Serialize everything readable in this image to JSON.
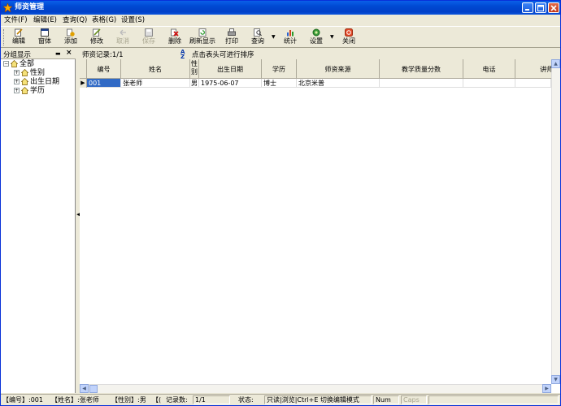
{
  "window": {
    "title": "师资管理"
  },
  "menu": [
    "文件(F)",
    "编辑(E)",
    "查询(Q)",
    "表格(G)",
    "设置(S)"
  ],
  "toolbar": {
    "edit": "编辑",
    "window": "窗体",
    "add": "添加",
    "modify": "修改",
    "cancel": "取消",
    "save": "保存",
    "delete": "删除",
    "refresh": "刷新显示",
    "print": "打印",
    "query": "查询",
    "stats": "统计",
    "settings": "设置",
    "close": "关闭"
  },
  "left_panel": {
    "title": "分组显示",
    "tree": {
      "root": "全部",
      "children": [
        "性别",
        "出生日期",
        "学历"
      ]
    }
  },
  "right_panel": {
    "record_count": "师资记录:1/1",
    "sort_icon": "sort-az-icon",
    "sort_hint": "点击表头可进行排序"
  },
  "grid": {
    "columns": [
      "编号",
      "姓名",
      "性别",
      "出生日期",
      "学历",
      "师资来源",
      "教学质量分数",
      "电话",
      "讲师"
    ],
    "rows": [
      [
        "001",
        "张老师",
        "男",
        "1975-06-07",
        "博士",
        "北京米普",
        "",
        "",
        ""
      ]
    ]
  },
  "statusbar": {
    "field_id": "【编号】:001",
    "field_name": "【姓名】:张老师",
    "field_gender": "【性别】:男",
    "field_cut": "【(",
    "record_label": "记录数:",
    "record_value": "1/1",
    "state_label": "状态:",
    "mode": "只读|浏览|Ctrl+E 切换编辑模式",
    "num": "Num",
    "caps": "Caps"
  },
  "colors": {
    "title_bar": "#0049d2",
    "selection": "#316ac5",
    "face": "#ece9d8"
  }
}
